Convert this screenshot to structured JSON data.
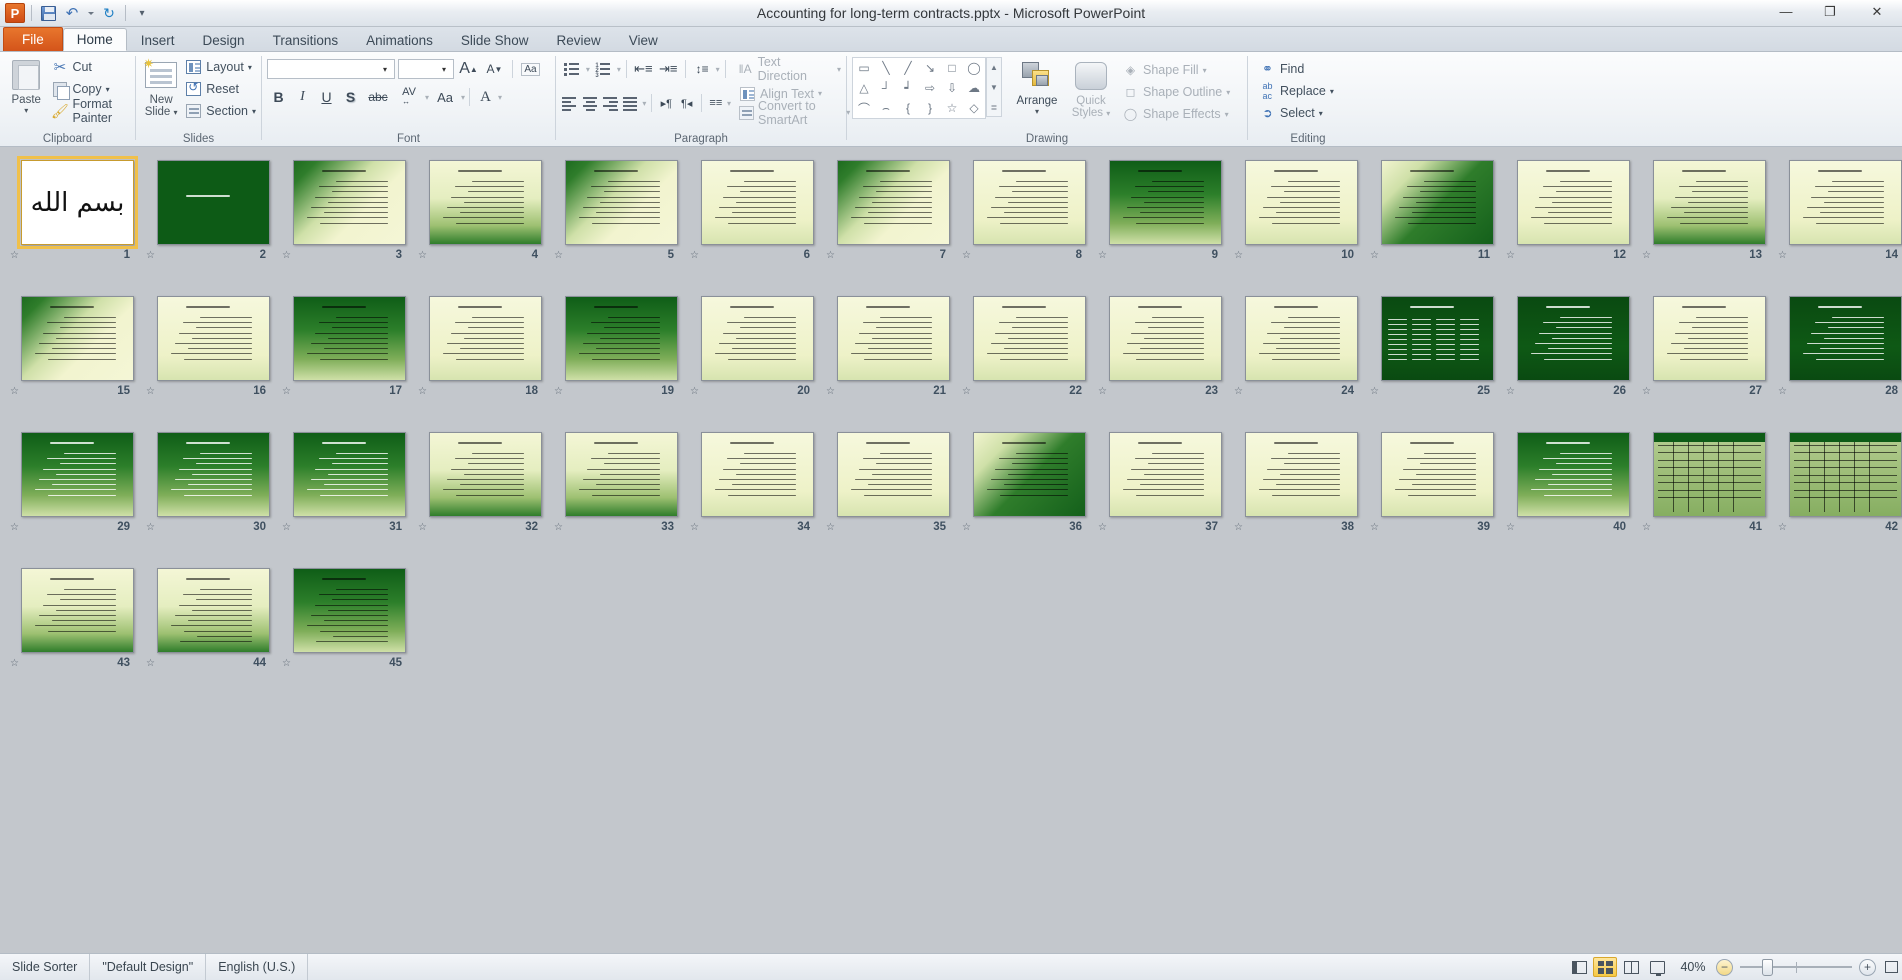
{
  "window": {
    "title": "Accounting for long-term contracts.pptx  -  Microsoft PowerPoint",
    "minimize": "—",
    "restore": "❐",
    "close": "✕"
  },
  "quick_access": {
    "app_logo": "P",
    "save": "save-icon",
    "undo": "↶",
    "undo_caret": "▾",
    "redo": "↻",
    "customize": "▾"
  },
  "tabs": [
    {
      "label": "File",
      "type": "file"
    },
    {
      "label": "Home",
      "type": "active"
    },
    {
      "label": "Insert",
      "type": "normal"
    },
    {
      "label": "Design",
      "type": "normal"
    },
    {
      "label": "Transitions",
      "type": "normal"
    },
    {
      "label": "Animations",
      "type": "normal"
    },
    {
      "label": "Slide Show",
      "type": "normal"
    },
    {
      "label": "Review",
      "type": "normal"
    },
    {
      "label": "View",
      "type": "normal"
    }
  ],
  "ribbon": {
    "clipboard": {
      "label": "Clipboard",
      "paste": "Paste",
      "paste_caret": "▾",
      "cut": "Cut",
      "copy": "Copy",
      "copy_caret": "▾",
      "format_painter": "Format Painter"
    },
    "slides": {
      "label": "Slides",
      "new_slide": "New\nSlide",
      "new_slide_line1": "New",
      "new_slide_line2": "Slide",
      "new_slide_caret": "▾",
      "layout": "Layout",
      "layout_caret": "▾",
      "reset": "Reset",
      "section": "Section",
      "section_caret": "▾"
    },
    "font": {
      "label": "Font",
      "font_name_value": "",
      "font_size_value": "",
      "caret": "▾",
      "grow_font": "A",
      "shrink_font": "A",
      "clear_formatting": "Aa",
      "bold": "B",
      "italic": "I",
      "underline": "U",
      "shadow": "S",
      "strikethrough": "abc",
      "char_spacing": "AV",
      "change_case": "Aa",
      "font_color": "A"
    },
    "paragraph": {
      "label": "Paragraph",
      "bullets": "bullets-icon",
      "numbering": "numbering-icon",
      "decrease_indent": "decrease-indent-icon",
      "increase_indent": "increase-indent-icon",
      "line_spacing": "line-spacing-icon",
      "align_left": "align-left-icon",
      "align_center": "align-center-icon",
      "align_right": "align-right-icon",
      "justify": "justify-icon",
      "ltr": "▸¶",
      "rtl": "¶◂",
      "columns": "columns-icon",
      "text_direction": "Text Direction",
      "align_text": "Align Text",
      "convert_to_smartart": "Convert to SmartArt",
      "caret": "▾"
    },
    "drawing": {
      "label": "Drawing",
      "shapes": [
        "▭",
        "╲",
        "╱",
        "↘",
        "□",
        "◯",
        "▢",
        "△",
        "┘",
        "┙",
        "⇨",
        "⇩",
        "☁",
        "⌒",
        "⌢",
        "{",
        "}",
        "☆",
        "◇"
      ],
      "scroll_up": "▲",
      "scroll_down": "▼",
      "scroll_more": "≣",
      "arrange": "Arrange",
      "arrange_caret": "▾",
      "quick_styles_line1": "Quick",
      "quick_styles_line2": "Styles",
      "quick_styles_caret": "▾",
      "shape_fill": "Shape Fill",
      "shape_outline": "Shape Outline",
      "shape_effects": "Shape Effects"
    },
    "editing": {
      "label": "Editing",
      "find": "Find",
      "replace": "Replace",
      "select": "Select",
      "caret": "▾"
    }
  },
  "status_bar": {
    "view_mode": "Slide Sorter",
    "theme": "\"Default Design\"",
    "language": "English (U.S.)",
    "zoom_level": "40%",
    "zoom_out": "−",
    "zoom_in": "+",
    "views": [
      {
        "name": "normal-view",
        "label": "Normal",
        "active": false
      },
      {
        "name": "slide-sorter-view",
        "label": "Slide Sorter",
        "active": true
      },
      {
        "name": "reading-view",
        "label": "Reading View",
        "active": false
      },
      {
        "name": "slide-show-view",
        "label": "Slide Show",
        "active": false
      }
    ],
    "fit_to_window": "Fit slide to current window"
  },
  "slide_sorter": {
    "columns": 14,
    "rows": 4,
    "total_slides": 45,
    "selected_slide": 1,
    "slides": [
      {
        "n": 1,
        "style": "bg-white",
        "kind": "calligraphy",
        "star": true
      },
      {
        "n": 2,
        "style": "bg-darkgreen",
        "kind": "title-only",
        "star": true
      },
      {
        "n": 3,
        "style": "bg-cream-diag",
        "kind": "banner-text",
        "star": true
      },
      {
        "n": 4,
        "style": "bg-cream-vert",
        "kind": "banner-text",
        "star": true
      },
      {
        "n": 5,
        "style": "bg-cream-diag",
        "kind": "banner-text",
        "star": true
      },
      {
        "n": 6,
        "style": "bg-cream-plain",
        "kind": "text",
        "star": true
      },
      {
        "n": 7,
        "style": "bg-cream-diag",
        "kind": "text",
        "star": true
      },
      {
        "n": 8,
        "style": "bg-cream-plain",
        "kind": "text",
        "star": true
      },
      {
        "n": 9,
        "style": "bg-green-vert",
        "kind": "text",
        "star": true
      },
      {
        "n": 10,
        "style": "bg-cream-plain",
        "kind": "text",
        "star": true
      },
      {
        "n": 11,
        "style": "bg-green-diag",
        "kind": "text",
        "star": true
      },
      {
        "n": 12,
        "style": "bg-cream-plain",
        "kind": "text",
        "star": true
      },
      {
        "n": 13,
        "style": "bg-cream-vert",
        "kind": "text",
        "star": true
      },
      {
        "n": 14,
        "style": "bg-cream-plain",
        "kind": "text",
        "star": true
      },
      {
        "n": 15,
        "style": "bg-cream-diag",
        "kind": "text",
        "star": true
      },
      {
        "n": 16,
        "style": "bg-cream-plain",
        "kind": "text",
        "star": true
      },
      {
        "n": 17,
        "style": "bg-green-vert",
        "kind": "text",
        "star": true
      },
      {
        "n": 18,
        "style": "bg-cream-plain",
        "kind": "text",
        "star": true
      },
      {
        "n": 19,
        "style": "bg-green-vert",
        "kind": "text",
        "star": true
      },
      {
        "n": 20,
        "style": "bg-cream-plain",
        "kind": "text",
        "star": true
      },
      {
        "n": 21,
        "style": "bg-cream-plain",
        "kind": "text",
        "star": true
      },
      {
        "n": 22,
        "style": "bg-cream-plain",
        "kind": "text",
        "star": true
      },
      {
        "n": 23,
        "style": "bg-cream-plain",
        "kind": "text",
        "star": true
      },
      {
        "n": 24,
        "style": "bg-cream-plain",
        "kind": "text",
        "star": true
      },
      {
        "n": 25,
        "style": "bg-dark-chart",
        "kind": "orgchart",
        "star": true
      },
      {
        "n": 26,
        "style": "bg-dark-chart",
        "kind": "text-light",
        "star": true
      },
      {
        "n": 27,
        "style": "bg-cream-plain",
        "kind": "text",
        "star": true
      },
      {
        "n": 28,
        "style": "bg-dark-chart",
        "kind": "text-light",
        "star": true
      },
      {
        "n": 29,
        "style": "bg-green-vert",
        "kind": "text-light",
        "star": true
      },
      {
        "n": 30,
        "style": "bg-green-vert",
        "kind": "text-light",
        "star": true
      },
      {
        "n": 31,
        "style": "bg-green-vert",
        "kind": "text-light",
        "star": true
      },
      {
        "n": 32,
        "style": "bg-cream-vert",
        "kind": "text",
        "star": true
      },
      {
        "n": 33,
        "style": "bg-cream-vert",
        "kind": "text",
        "star": true
      },
      {
        "n": 34,
        "style": "bg-cream-plain",
        "kind": "text",
        "star": true
      },
      {
        "n": 35,
        "style": "bg-cream-plain",
        "kind": "text",
        "star": true
      },
      {
        "n": 36,
        "style": "bg-green-diag",
        "kind": "text",
        "star": true
      },
      {
        "n": 37,
        "style": "bg-cream-plain",
        "kind": "text",
        "star": true
      },
      {
        "n": 38,
        "style": "bg-cream-plain",
        "kind": "text",
        "star": true
      },
      {
        "n": 39,
        "style": "bg-cream-plain",
        "kind": "text",
        "star": true
      },
      {
        "n": 40,
        "style": "bg-green-vert",
        "kind": "text-light",
        "star": true
      },
      {
        "n": 41,
        "style": "bg-table",
        "kind": "table",
        "star": true
      },
      {
        "n": 42,
        "style": "bg-table",
        "kind": "table",
        "star": true
      },
      {
        "n": 43,
        "style": "bg-cream-vert",
        "kind": "text",
        "star": true
      },
      {
        "n": 44,
        "style": "bg-cream-vert",
        "kind": "table-text",
        "star": true
      },
      {
        "n": 45,
        "style": "bg-green-vert",
        "kind": "table-text",
        "star": true
      }
    ]
  }
}
